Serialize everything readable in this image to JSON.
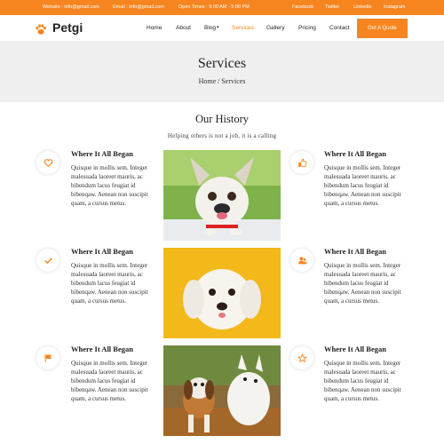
{
  "topbar": {
    "website": "Website : info@gmail.com",
    "email": "Email : info@gmail.com",
    "hours": "Open Times : 9:00 AM - 5:00 PM",
    "social": [
      "Facebook",
      "Twitter",
      "Linkedin",
      "Instagram"
    ]
  },
  "brand": "Petgi",
  "nav": {
    "items": [
      "Home",
      "About",
      "Blog",
      "Services",
      "Gallery",
      "Pricing",
      "Contact"
    ],
    "active": "Services",
    "quote_button": "Get A Quote"
  },
  "banner": {
    "title": "Services",
    "breadcrumb": "Home / Services"
  },
  "section": {
    "title": "Our History",
    "subtitle": "Helping others is not a job, it is a calling"
  },
  "features": [
    {
      "icon": "heart-icon",
      "title": "Where It All Began",
      "text": "Quisque in mollis sem. Integer malesuada laoreet mauris, ac bibendum lacus feugiat id bibenqaw. Aenean non suscipit quam, a cursus metus."
    },
    {
      "icon": "thumbs-up-icon",
      "title": "Where It All Began",
      "text": "Quisque in mollis sem. Integer malesuada laoreet mauris, ac bibendum lacus feugiat id bibenqaw. Aenean non suscipit quam, a cursus metus."
    },
    {
      "icon": "check-icon",
      "title": "Where It All Began",
      "text": "Quisque in mollis sem. Integer malesuada laoreet mauris, ac bibendum lacus feugiat id bibenqaw. Aenean non suscipit quam, a cursus metus."
    },
    {
      "icon": "users-icon",
      "title": "Where It All Began",
      "text": "Quisque in mollis sem. Integer malesuada laoreet mauris, ac bibendum lacus feugiat id bibenqaw. Aenean non suscipit quam, a cursus metus."
    },
    {
      "icon": "flag-icon",
      "title": "Where It All Began",
      "text": "Quisque in mollis sem. Integer malesuada laoreet mauris, ac bibendum lacus feugiat id bibenqaw. Aenean non suscipit quam, a cursus metus."
    },
    {
      "icon": "star-icon",
      "title": "Where It All Began",
      "text": "Quisque in mollis sem. Integer malesuada laoreet mauris, ac bibendum lacus feugiat id bibenqaw. Aenean non suscipit quam, a cursus metus."
    }
  ],
  "colors": {
    "accent": "#f6851f",
    "banner_bg": "#efefef"
  }
}
